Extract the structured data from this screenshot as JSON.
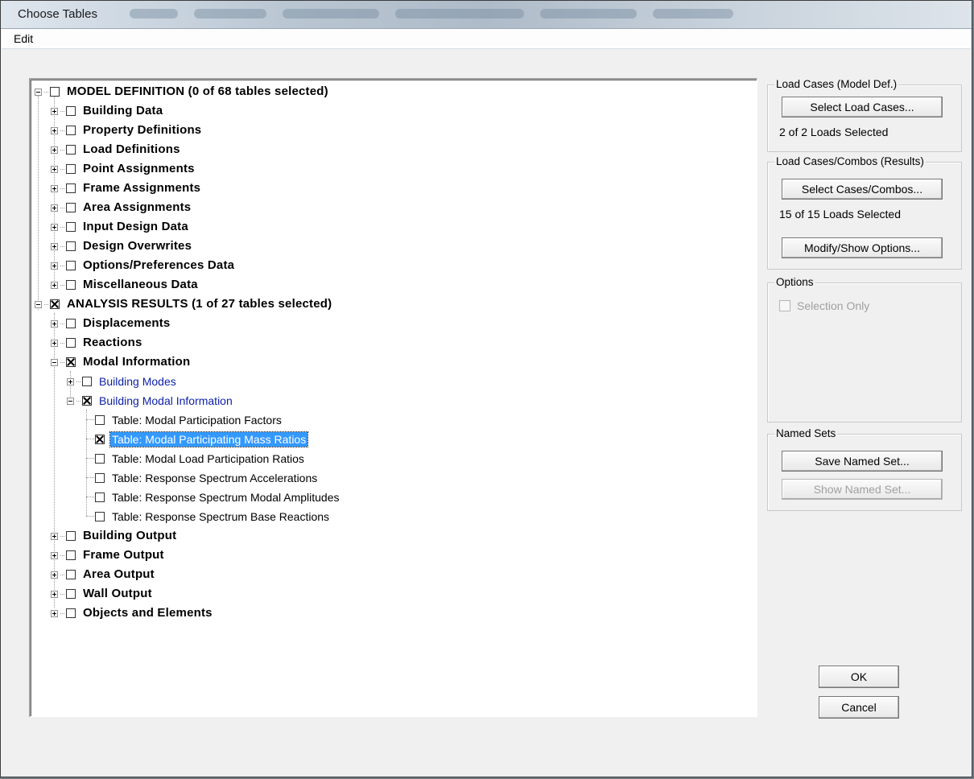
{
  "window": {
    "title": "Choose Tables"
  },
  "menu": {
    "edit": "Edit"
  },
  "tree": {
    "model_definition": {
      "label": "MODEL DEFINITION  (0 of 68 tables selected)",
      "children": [
        "Building Data",
        "Property Definitions",
        "Load Definitions",
        "Point Assignments",
        "Frame Assignments",
        "Area Assignments",
        "Input Design Data",
        "Design Overwrites",
        "Options/Preferences Data",
        "Miscellaneous Data"
      ]
    },
    "analysis_results": {
      "label": "ANALYSIS RESULTS  (1 of 27 tables selected)",
      "displacements": "Displacements",
      "reactions": "Reactions",
      "modal_information": "Modal Information",
      "building_modes": "Building Modes",
      "building_modal_information": "Building Modal Information",
      "tables": [
        "Table:  Modal Participation Factors",
        "Table:  Modal Participating Mass Ratios",
        "Table:  Modal Load Participation Ratios",
        "Table:  Response Spectrum Accelerations",
        "Table:  Response Spectrum Modal Amplitudes",
        "Table:  Response Spectrum Base Reactions"
      ],
      "after": [
        "Building Output",
        "Frame Output",
        "Area Output",
        "Wall Output",
        "Objects and Elements"
      ]
    }
  },
  "load_cases_model": {
    "title": "Load Cases (Model Def.)",
    "button": "Select Load Cases...",
    "status": "2  of  2  Loads Selected"
  },
  "load_cases_results": {
    "title": "Load Cases/Combos (Results)",
    "button": "Select Cases/Combos...",
    "status": "15  of  15  Loads Selected",
    "modify_button": "Modify/Show Options..."
  },
  "options": {
    "title": "Options",
    "selection_only": "Selection Only"
  },
  "named_sets": {
    "title": "Named Sets",
    "save": "Save Named Set...",
    "show": "Show Named Set..."
  },
  "dialog": {
    "ok": "OK",
    "cancel": "Cancel"
  }
}
